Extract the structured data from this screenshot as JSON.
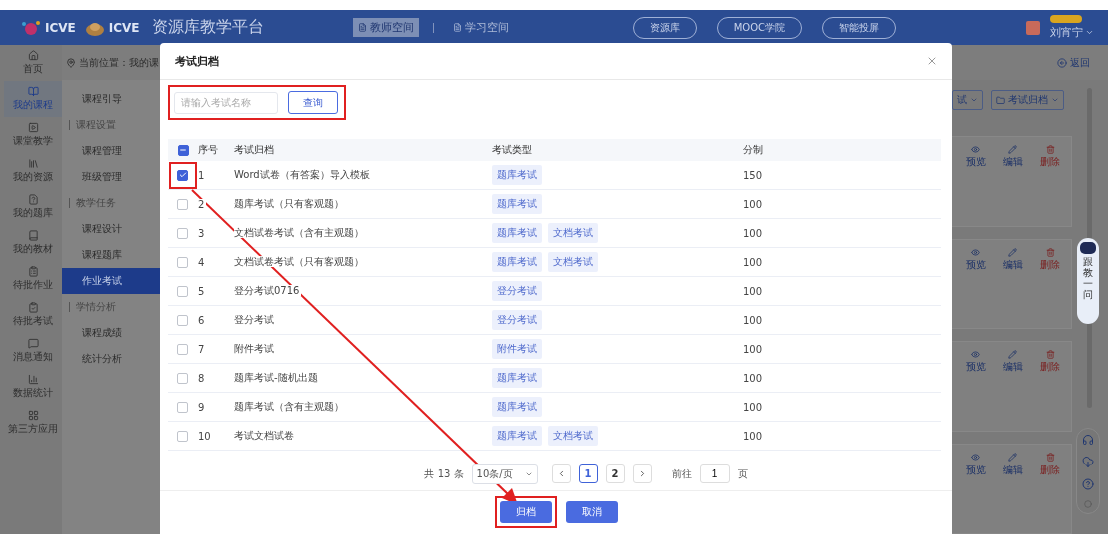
{
  "header": {
    "logos": [
      "ICVE",
      "ICVE"
    ],
    "title": "资源库教学平台",
    "space_tabs": [
      {
        "label": "教师空间",
        "selected": true
      },
      {
        "label": "学习空间",
        "selected": false
      }
    ],
    "links": [
      "资源库",
      "MOOC学院",
      "智能投屏"
    ],
    "user": "刘宵宁"
  },
  "nav_rail": [
    {
      "label": "首页",
      "selected": false
    },
    {
      "label": "我的课程",
      "selected": true
    },
    {
      "label": "课堂教学",
      "selected": false
    },
    {
      "label": "我的资源",
      "selected": false
    },
    {
      "label": "我的题库",
      "selected": false
    },
    {
      "label": "我的教材",
      "selected": false
    },
    {
      "label": "待批作业",
      "selected": false
    },
    {
      "label": "待批考试",
      "selected": false
    },
    {
      "label": "消息通知",
      "selected": false
    },
    {
      "label": "数据统计",
      "selected": false
    },
    {
      "label": "第三方应用",
      "selected": false
    }
  ],
  "course_menu": [
    {
      "kind": "item",
      "label": "课程引导",
      "selected": false
    },
    {
      "kind": "section",
      "label": "课程设置"
    },
    {
      "kind": "item",
      "label": "课程管理",
      "selected": false
    },
    {
      "kind": "item",
      "label": "班级管理",
      "selected": false
    },
    {
      "kind": "section",
      "label": "教学任务"
    },
    {
      "kind": "item",
      "label": "课程设计",
      "selected": false
    },
    {
      "kind": "item",
      "label": "课程题库",
      "selected": false
    },
    {
      "kind": "item",
      "label": "作业考试",
      "selected": true
    },
    {
      "kind": "section",
      "label": "学情分析"
    },
    {
      "kind": "item",
      "label": "课程成绩",
      "selected": false
    },
    {
      "kind": "item",
      "label": "统计分析",
      "selected": false
    }
  ],
  "breadcrumb": "当前位置：我的课",
  "back": "返回",
  "filters": [
    "试",
    "考试归档"
  ],
  "cards": [
    {
      "actions": [
        "预览",
        "编辑",
        "删除"
      ]
    },
    {
      "actions": [
        "预览",
        "编辑",
        "删除"
      ]
    },
    {
      "actions": [
        "预览",
        "编辑",
        "删除"
      ]
    },
    {
      "actions": [
        "预览",
        "编辑",
        "删除"
      ]
    }
  ],
  "assistant": "跟教一问",
  "dialog": {
    "title": "考试归档",
    "search": {
      "placeholder": "请输入考试名称",
      "button": "查询",
      "highlighted": true
    },
    "columns": [
      "序号",
      "考试归档",
      "考试类型",
      "分制"
    ],
    "select_all_partial": true,
    "rows": [
      {
        "index": "1",
        "name": "Word试卷（有答案）导入模板",
        "types": [
          "题库考试"
        ],
        "score": "150",
        "checked": true,
        "highlighted": true
      },
      {
        "index": "2",
        "name": "题库考试（只有客观题）",
        "types": [
          "题库考试"
        ],
        "score": "100",
        "checked": false,
        "highlighted": false
      },
      {
        "index": "3",
        "name": "文档试卷考试（含有主观题）",
        "types": [
          "题库考试",
          "文档考试"
        ],
        "score": "100",
        "checked": false,
        "highlighted": false
      },
      {
        "index": "4",
        "name": "文档试卷考试（只有客观题）",
        "types": [
          "题库考试",
          "文档考试"
        ],
        "score": "100",
        "checked": false,
        "highlighted": false
      },
      {
        "index": "5",
        "name": "登分考试0716",
        "types": [
          "登分考试"
        ],
        "score": "100",
        "checked": false,
        "highlighted": false
      },
      {
        "index": "6",
        "name": "登分考试",
        "types": [
          "登分考试"
        ],
        "score": "100",
        "checked": false,
        "highlighted": false
      },
      {
        "index": "7",
        "name": "附件考试",
        "types": [
          "附件考试"
        ],
        "score": "100",
        "checked": false,
        "highlighted": false
      },
      {
        "index": "8",
        "name": "题库考试-随机出题",
        "types": [
          "题库考试"
        ],
        "score": "100",
        "checked": false,
        "highlighted": false
      },
      {
        "index": "9",
        "name": "题库考试（含有主观题）",
        "types": [
          "题库考试"
        ],
        "score": "100",
        "checked": false,
        "highlighted": false
      },
      {
        "index": "10",
        "name": "考试文档试卷",
        "types": [
          "题库考试",
          "文档考试"
        ],
        "score": "100",
        "checked": false,
        "highlighted": false
      }
    ],
    "pagination": {
      "total": "共 13 条",
      "page_size": "10条/页",
      "pages": [
        {
          "label": "1",
          "selected": true
        },
        {
          "label": "2",
          "selected": false
        }
      ],
      "goto_label": "前往",
      "goto_value": "1",
      "goto_suffix": "页"
    },
    "buttons": [
      {
        "label": "归档",
        "highlighted": true
      },
      {
        "label": "取消",
        "highlighted": false
      }
    ]
  }
}
